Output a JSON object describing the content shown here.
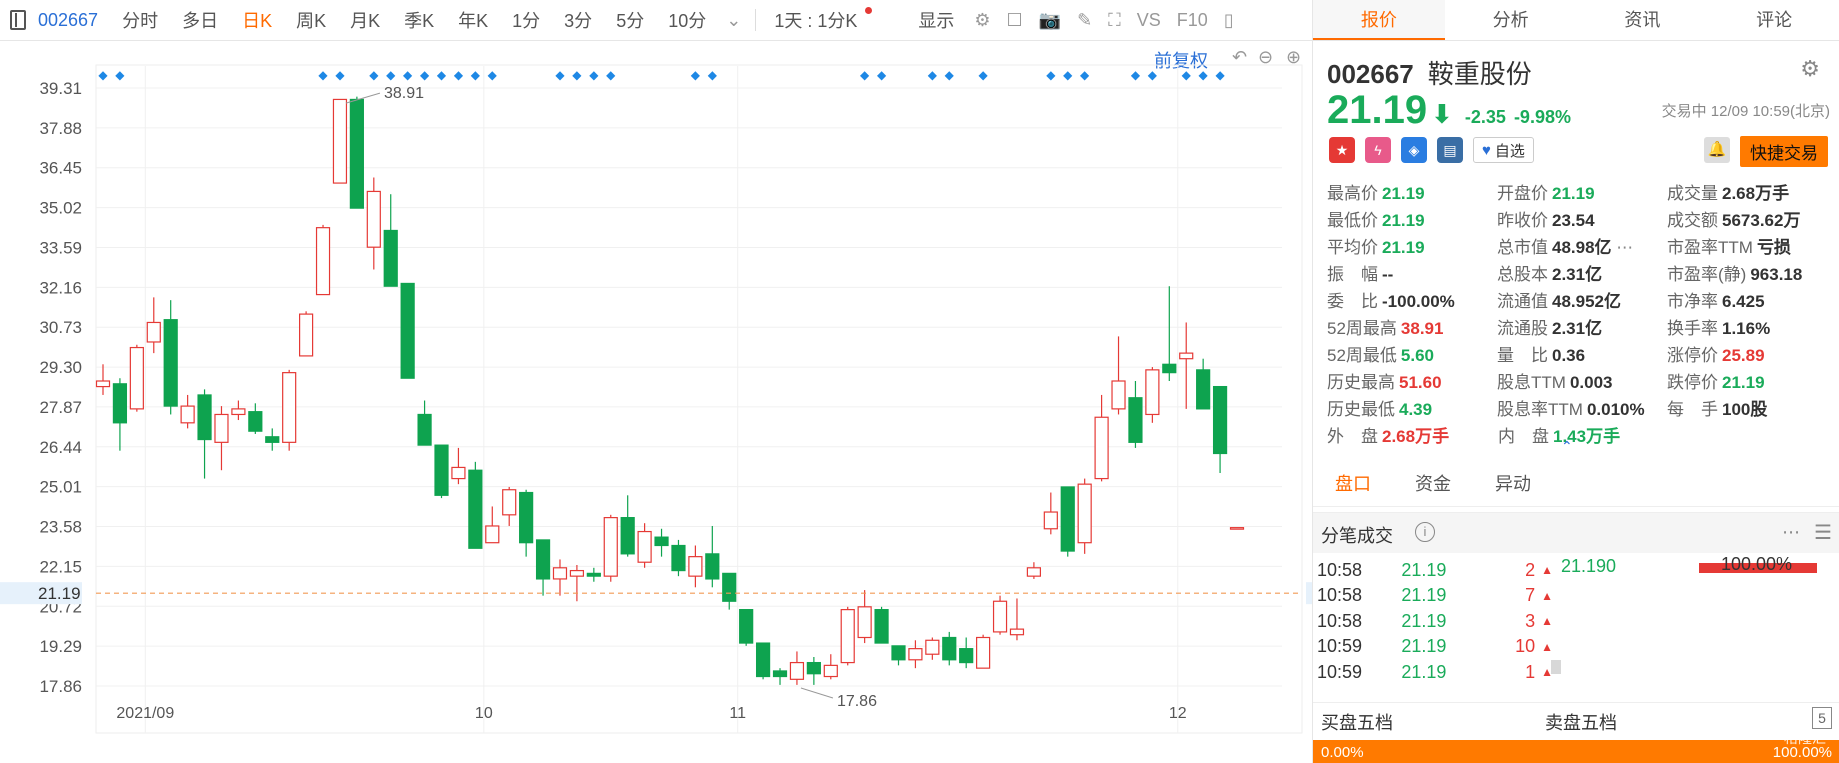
{
  "toolbar": {
    "code": "002667",
    "periods": [
      "分时",
      "多日",
      "日K",
      "周K",
      "月K",
      "季K",
      "年K",
      "1分",
      "3分",
      "5分",
      "10分"
    ],
    "active_period": "日K",
    "range": "1天 : 1分K",
    "display": "显示",
    "vs_label": "VS",
    "f10_label": "F10"
  },
  "chart_controls": {
    "restore": "前复权"
  },
  "chart_data": {
    "type": "candlestick",
    "y_ticks": [
      "39.31",
      "37.88",
      "36.45",
      "35.02",
      "33.59",
      "32.16",
      "30.73",
      "29.30",
      "27.87",
      "26.44",
      "25.01",
      "23.58",
      "22.15",
      "20.72",
      "19.29",
      "17.86"
    ],
    "ylim": [
      17.86,
      39.31
    ],
    "x_labels": [
      "2021/09",
      "10",
      "11",
      "12"
    ],
    "current_price_label": "21.19",
    "current_price": 21.19,
    "annotations": [
      {
        "text": "38.91",
        "value": 38.91
      },
      {
        "text": "17.86",
        "value": 17.86
      }
    ],
    "candles": [
      {
        "o": 28.6,
        "c": 28.8,
        "h": 29.4,
        "l": 28.3
      },
      {
        "o": 28.7,
        "c": 27.3,
        "h": 28.9,
        "l": 26.3
      },
      {
        "o": 27.8,
        "c": 30.0,
        "h": 30.1,
        "l": 27.7
      },
      {
        "o": 30.2,
        "c": 30.9,
        "h": 31.8,
        "l": 29.8
      },
      {
        "o": 31.0,
        "c": 27.9,
        "h": 31.7,
        "l": 27.6
      },
      {
        "o": 27.3,
        "c": 27.9,
        "h": 28.3,
        "l": 27.1
      },
      {
        "o": 28.3,
        "c": 26.7,
        "h": 28.5,
        "l": 25.3
      },
      {
        "o": 26.6,
        "c": 27.6,
        "h": 27.9,
        "l": 25.6
      },
      {
        "o": 27.6,
        "c": 27.8,
        "h": 28.1,
        "l": 27.4
      },
      {
        "o": 27.7,
        "c": 27.0,
        "h": 28.0,
        "l": 26.9
      },
      {
        "o": 26.8,
        "c": 26.6,
        "h": 27.1,
        "l": 26.3
      },
      {
        "o": 26.6,
        "c": 29.1,
        "h": 29.2,
        "l": 26.3
      },
      {
        "o": 29.7,
        "c": 31.2,
        "h": 31.3,
        "l": 29.7
      },
      {
        "o": 31.9,
        "c": 34.3,
        "h": 34.4,
        "l": 31.9
      },
      {
        "o": 35.9,
        "c": 38.9,
        "h": 38.9,
        "l": 35.9
      },
      {
        "o": 38.9,
        "c": 35.0,
        "h": 39.0,
        "l": 35.0
      },
      {
        "o": 33.6,
        "c": 35.6,
        "h": 36.1,
        "l": 32.8
      },
      {
        "o": 34.2,
        "c": 32.2,
        "h": 35.5,
        "l": 32.2
      },
      {
        "o": 32.3,
        "c": 28.9,
        "h": 32.3,
        "l": 28.9
      },
      {
        "o": 27.6,
        "c": 26.5,
        "h": 28.1,
        "l": 26.5
      },
      {
        "o": 26.5,
        "c": 24.7,
        "h": 26.5,
        "l": 24.6
      },
      {
        "o": 25.3,
        "c": 25.7,
        "h": 26.4,
        "l": 25.1
      },
      {
        "o": 25.6,
        "c": 22.8,
        "h": 25.9,
        "l": 22.8
      },
      {
        "o": 23.0,
        "c": 23.6,
        "h": 24.3,
        "l": 23.0
      },
      {
        "o": 24.0,
        "c": 24.9,
        "h": 25.0,
        "l": 23.6
      },
      {
        "o": 24.8,
        "c": 23.0,
        "h": 24.9,
        "l": 22.5
      },
      {
        "o": 23.1,
        "c": 21.7,
        "h": 23.1,
        "l": 21.1
      },
      {
        "o": 21.7,
        "c": 22.1,
        "h": 22.4,
        "l": 21.1
      },
      {
        "o": 21.8,
        "c": 22.0,
        "h": 22.2,
        "l": 20.9
      },
      {
        "o": 21.9,
        "c": 21.8,
        "h": 22.1,
        "l": 21.6
      },
      {
        "o": 21.8,
        "c": 23.9,
        "h": 24.0,
        "l": 21.6
      },
      {
        "o": 23.9,
        "c": 22.6,
        "h": 24.7,
        "l": 22.5
      },
      {
        "o": 22.3,
        "c": 23.4,
        "h": 23.7,
        "l": 22.1
      },
      {
        "o": 23.2,
        "c": 22.9,
        "h": 23.5,
        "l": 22.5
      },
      {
        "o": 22.9,
        "c": 22.0,
        "h": 23.1,
        "l": 21.8
      },
      {
        "o": 21.8,
        "c": 22.5,
        "h": 22.9,
        "l": 21.4
      },
      {
        "o": 22.6,
        "c": 21.7,
        "h": 23.6,
        "l": 21.4
      },
      {
        "o": 21.9,
        "c": 20.9,
        "h": 21.9,
        "l": 20.6
      },
      {
        "o": 20.6,
        "c": 19.4,
        "h": 20.6,
        "l": 19.3
      },
      {
        "o": 19.4,
        "c": 18.2,
        "h": 19.4,
        "l": 18.1
      },
      {
        "o": 18.4,
        "c": 18.2,
        "h": 18.5,
        "l": 17.9
      },
      {
        "o": 18.1,
        "c": 18.7,
        "h": 19.1,
        "l": 17.9
      },
      {
        "o": 18.7,
        "c": 18.3,
        "h": 18.9,
        "l": 17.9
      },
      {
        "o": 18.2,
        "c": 18.6,
        "h": 19.0,
        "l": 18.1
      },
      {
        "o": 18.7,
        "c": 20.6,
        "h": 20.7,
        "l": 18.6
      },
      {
        "o": 19.6,
        "c": 20.7,
        "h": 21.3,
        "l": 19.4
      },
      {
        "o": 20.6,
        "c": 19.4,
        "h": 20.7,
        "l": 19.4
      },
      {
        "o": 19.3,
        "c": 18.8,
        "h": 19.3,
        "l": 18.6
      },
      {
        "o": 18.8,
        "c": 19.2,
        "h": 19.5,
        "l": 18.5
      },
      {
        "o": 19.0,
        "c": 19.5,
        "h": 19.6,
        "l": 18.8
      },
      {
        "o": 19.6,
        "c": 18.8,
        "h": 19.8,
        "l": 18.6
      },
      {
        "o": 19.2,
        "c": 18.7,
        "h": 19.6,
        "l": 18.5
      },
      {
        "o": 18.5,
        "c": 19.6,
        "h": 19.7,
        "l": 18.5
      },
      {
        "o": 19.8,
        "c": 20.9,
        "h": 21.1,
        "l": 19.7
      },
      {
        "o": 19.7,
        "c": 19.9,
        "h": 21.0,
        "l": 19.5
      },
      {
        "o": 21.8,
        "c": 22.1,
        "h": 22.3,
        "l": 21.7
      },
      {
        "o": 23.5,
        "c": 24.1,
        "h": 24.8,
        "l": 23.3
      },
      {
        "o": 25.0,
        "c": 22.7,
        "h": 25.0,
        "l": 22.5
      },
      {
        "o": 23.0,
        "c": 25.1,
        "h": 25.3,
        "l": 22.6
      },
      {
        "o": 25.3,
        "c": 27.5,
        "h": 28.3,
        "l": 25.2
      },
      {
        "o": 27.8,
        "c": 28.8,
        "h": 30.4,
        "l": 27.6
      },
      {
        "o": 28.2,
        "c": 26.6,
        "h": 28.8,
        "l": 26.4
      },
      {
        "o": 27.6,
        "c": 29.2,
        "h": 29.3,
        "l": 27.3
      },
      {
        "o": 29.4,
        "c": 29.1,
        "h": 32.2,
        "l": 28.8
      },
      {
        "o": 29.6,
        "c": 29.8,
        "h": 30.9,
        "l": 27.8
      },
      {
        "o": 29.2,
        "c": 27.8,
        "h": 29.6,
        "l": 27.8
      },
      {
        "o": 28.6,
        "c": 26.2,
        "h": 28.6,
        "l": 25.5
      },
      {
        "o": 23.54,
        "c": 23.54,
        "h": 23.54,
        "l": 23.54
      }
    ],
    "event_marker_indices": [
      0,
      1,
      13,
      14,
      16,
      17,
      18,
      19,
      20,
      21,
      22,
      23,
      27,
      28,
      29,
      30,
      35,
      36,
      45,
      46,
      49,
      50,
      52,
      56,
      57,
      58,
      61,
      62,
      64,
      65,
      66
    ]
  },
  "tabs": [
    "报价",
    "分析",
    "资讯",
    "评论"
  ],
  "stock": {
    "code": "002667",
    "name": "鞍重股份",
    "price": "21.19",
    "change": "-2.35",
    "change_pct": "-9.98%",
    "status": "交易中 12/09 10:59(北京)",
    "watch": "自选",
    "quick_trade": "快捷交易"
  },
  "stats": [
    [
      {
        "l": "最高价",
        "v": "21.19",
        "c": "down"
      },
      {
        "l": "开盘价",
        "v": "21.19",
        "c": "down"
      },
      {
        "l": "成交量",
        "v": "2.68万手",
        "c": ""
      }
    ],
    [
      {
        "l": "最低价",
        "v": "21.19",
        "c": "down"
      },
      {
        "l": "昨收价",
        "v": "23.54",
        "c": ""
      },
      {
        "l": "成交额",
        "v": "5673.62万",
        "c": ""
      }
    ],
    [
      {
        "l": "平均价",
        "v": "21.19",
        "c": "down"
      },
      {
        "l": "总市值",
        "v": "48.98亿",
        "c": ""
      },
      {
        "l": "市盈率TTM",
        "v": "亏损",
        "c": ""
      }
    ],
    [
      {
        "l": "振　幅",
        "v": "--",
        "c": ""
      },
      {
        "l": "总股本",
        "v": "2.31亿",
        "c": ""
      },
      {
        "l": "市盈率(静)",
        "v": "963.18",
        "c": ""
      }
    ],
    [
      {
        "l": "委　比",
        "v": "-100.00%",
        "c": ""
      },
      {
        "l": "流通值",
        "v": "48.952亿",
        "c": ""
      },
      {
        "l": "市净率",
        "v": "6.425",
        "c": ""
      }
    ],
    [
      {
        "l": "52周最高",
        "v": "38.91",
        "c": "up"
      },
      {
        "l": "流通股",
        "v": "2.31亿",
        "c": ""
      },
      {
        "l": "换手率",
        "v": "1.16%",
        "c": ""
      }
    ],
    [
      {
        "l": "52周最低",
        "v": "5.60",
        "c": "down"
      },
      {
        "l": "量　比",
        "v": "0.36",
        "c": ""
      },
      {
        "l": "涨停价",
        "v": "25.89",
        "c": "up"
      }
    ],
    [
      {
        "l": "历史最高",
        "v": "51.60",
        "c": "up"
      },
      {
        "l": "股息TTM",
        "v": "0.003",
        "c": ""
      },
      {
        "l": "跌停价",
        "v": "21.19",
        "c": "down"
      }
    ],
    [
      {
        "l": "历史最低",
        "v": "4.39",
        "c": "down"
      },
      {
        "l": "股息率TTM",
        "v": "0.010%",
        "c": ""
      },
      {
        "l": "每　手",
        "v": "100股",
        "c": ""
      }
    ],
    [
      {
        "l": "外　盘",
        "v": "2.68万手",
        "c": "up"
      },
      {
        "l": "内　盘",
        "v": "1.43万手",
        "c": "down"
      }
    ]
  ],
  "subtabs": [
    "盘口",
    "资金",
    "异动"
  ],
  "ticks_title": "分笔成交",
  "ticks": [
    {
      "time": "10:58",
      "price": "21.19",
      "vol": "2"
    },
    {
      "time": "10:58",
      "price": "21.19",
      "vol": "7"
    },
    {
      "time": "10:58",
      "price": "21.19",
      "vol": "3"
    },
    {
      "time": "10:59",
      "price": "21.19",
      "vol": "10"
    },
    {
      "time": "10:59",
      "price": "21.19",
      "vol": "1"
    }
  ],
  "dist": {
    "price": "21.190",
    "pct": "100.00%"
  },
  "book": {
    "buy": "买盘五档",
    "sell": "卖盘五档",
    "five": "5"
  },
  "pressure": {
    "left": "0.00%",
    "right": "100.00%"
  },
  "watermark": "格隆汇",
  "colors": {
    "up": "#e53935",
    "down": "#1aab5a",
    "accent": "#ff6a00",
    "link": "#2a6fd6"
  }
}
